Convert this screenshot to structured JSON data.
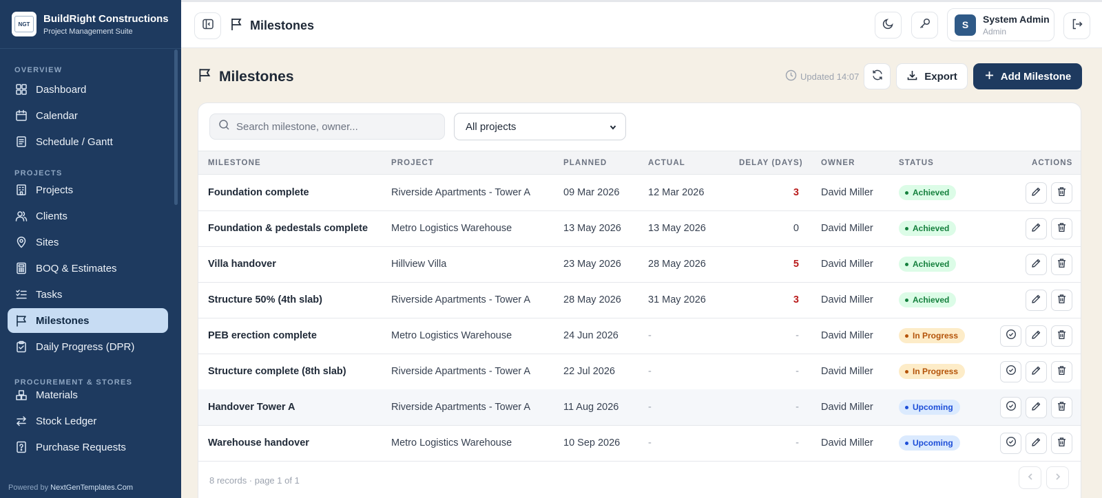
{
  "brand": {
    "name": "BuildRight Constructions",
    "subtitle": "Project Management Suite",
    "logo_text": "NGT"
  },
  "sidebar": {
    "sections": {
      "overview": "OVERVIEW",
      "projects": "PROJECTS",
      "procurement": "PROCUREMENT & STORES"
    },
    "items": [
      {
        "label": "Dashboard",
        "icon": "grid-icon"
      },
      {
        "label": "Calendar",
        "icon": "calendar-icon"
      },
      {
        "label": "Schedule / Gantt",
        "icon": "schedule-icon"
      },
      {
        "label": "Projects",
        "icon": "building-icon"
      },
      {
        "label": "Clients",
        "icon": "users-icon"
      },
      {
        "label": "Sites",
        "icon": "map-pin-icon"
      },
      {
        "label": "BOQ & Estimates",
        "icon": "calculator-icon"
      },
      {
        "label": "Tasks",
        "icon": "checklist-icon"
      },
      {
        "label": "Milestones",
        "icon": "flag-icon",
        "active": true
      },
      {
        "label": "Daily Progress (DPR)",
        "icon": "clipboard-icon"
      },
      {
        "label": "Materials",
        "icon": "boxes-icon"
      },
      {
        "label": "Stock Ledger",
        "icon": "transfer-icon"
      },
      {
        "label": "Purchase Requests",
        "icon": "request-icon"
      }
    ],
    "powered_prefix": "Powered by",
    "powered_link": "NextGenTemplates.Com"
  },
  "topbar": {
    "title": "Milestones",
    "user": {
      "initial": "S",
      "name": "System Admin",
      "role": "Admin"
    }
  },
  "page": {
    "title": "Milestones",
    "updated": "Updated 14:07",
    "export_label": "Export",
    "add_label": "Add Milestone"
  },
  "filters": {
    "search_placeholder": "Search milestone, owner...",
    "project_select": "All projects"
  },
  "table": {
    "headers": [
      "MILESTONE",
      "PROJECT",
      "PLANNED",
      "ACTUAL",
      "DELAY (DAYS)",
      "OWNER",
      "STATUS",
      "ACTIONS"
    ],
    "rows": [
      {
        "milestone": "Foundation complete",
        "project": "Riverside Apartments - Tower A",
        "planned": "09 Mar 2026",
        "actual": "12 Mar 2026",
        "delay": "3",
        "owner": "David Miller",
        "status": "Achieved"
      },
      {
        "milestone": "Foundation & pedestals complete",
        "project": "Metro Logistics Warehouse",
        "planned": "13 May 2026",
        "actual": "13 May 2026",
        "delay": "0",
        "owner": "David Miller",
        "status": "Achieved"
      },
      {
        "milestone": "Villa handover",
        "project": "Hillview Villa",
        "planned": "23 May 2026",
        "actual": "28 May 2026",
        "delay": "5",
        "owner": "David Miller",
        "status": "Achieved"
      },
      {
        "milestone": "Structure 50% (4th slab)",
        "project": "Riverside Apartments - Tower A",
        "planned": "28 May 2026",
        "actual": "31 May 2026",
        "delay": "3",
        "owner": "David Miller",
        "status": "Achieved"
      },
      {
        "milestone": "PEB erection complete",
        "project": "Metro Logistics Warehouse",
        "planned": "24 Jun 2026",
        "actual": "-",
        "delay": "-",
        "owner": "David Miller",
        "status": "In Progress"
      },
      {
        "milestone": "Structure complete (8th slab)",
        "project": "Riverside Apartments - Tower A",
        "planned": "22 Jul 2026",
        "actual": "-",
        "delay": "-",
        "owner": "David Miller",
        "status": "In Progress"
      },
      {
        "milestone": "Handover Tower A",
        "project": "Riverside Apartments - Tower A",
        "planned": "11 Aug 2026",
        "actual": "-",
        "delay": "-",
        "owner": "David Miller",
        "status": "Upcoming"
      },
      {
        "milestone": "Warehouse handover",
        "project": "Metro Logistics Warehouse",
        "planned": "10 Sep 2026",
        "actual": "-",
        "delay": "-",
        "owner": "David Miller",
        "status": "Upcoming"
      }
    ],
    "footer": "8 records · page 1 of 1"
  },
  "status_colors": {
    "Achieved": {
      "bg": "#dcfce7",
      "fg": "#15803d"
    },
    "In Progress": {
      "bg": "#fdecc8",
      "fg": "#b45309"
    },
    "Upcoming": {
      "bg": "#dbeafe",
      "fg": "#1d4ed8"
    }
  },
  "colors": {
    "sidebar": "#1e3a5f",
    "accent": "#1e3a5f",
    "delay_red": "#b91c1c"
  }
}
